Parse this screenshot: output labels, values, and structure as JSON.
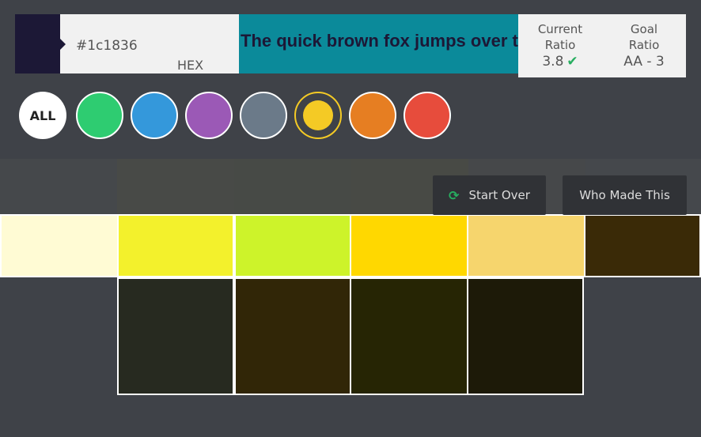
{
  "current_color": {
    "hex": "#1c1836",
    "format_label": "HEX"
  },
  "preview": {
    "text": "The quick brown fox jumps over the lazy dog",
    "background": "#0b8a9a",
    "text_color": "#1c1836"
  },
  "ratio": {
    "current_label": "Current\nRatio",
    "current_label_line1": "Current",
    "current_label_line2": "Ratio",
    "current_value": "3.8",
    "goal_label_line1": "Goal",
    "goal_label_line2": "Ratio",
    "goal_value": "AA - 3",
    "status_icon": "check-icon"
  },
  "filters": [
    {
      "name": "all",
      "label": "ALL"
    },
    {
      "name": "green",
      "color": "#2ecc71"
    },
    {
      "name": "blue",
      "color": "#3498db"
    },
    {
      "name": "purple",
      "color": "#9b59b6"
    },
    {
      "name": "gray",
      "color": "#6b7a89"
    },
    {
      "name": "yellow",
      "color": "#f4ca25",
      "selected": true
    },
    {
      "name": "orange",
      "color": "#e67e22"
    },
    {
      "name": "red",
      "color": "#e74c3c"
    }
  ],
  "buttons": {
    "start_over": "Start Over",
    "start_over_icon": "refresh-icon",
    "who_made": "Who Made This"
  },
  "swatches": {
    "row1": [
      "#fffbd4",
      "#f3f12c",
      "#cdf32a",
      "#ffd800",
      "#f6d56d",
      "#3a2a07"
    ],
    "row2": [
      "#272a20",
      "#312607",
      "#262504",
      "#1d1a08"
    ]
  }
}
